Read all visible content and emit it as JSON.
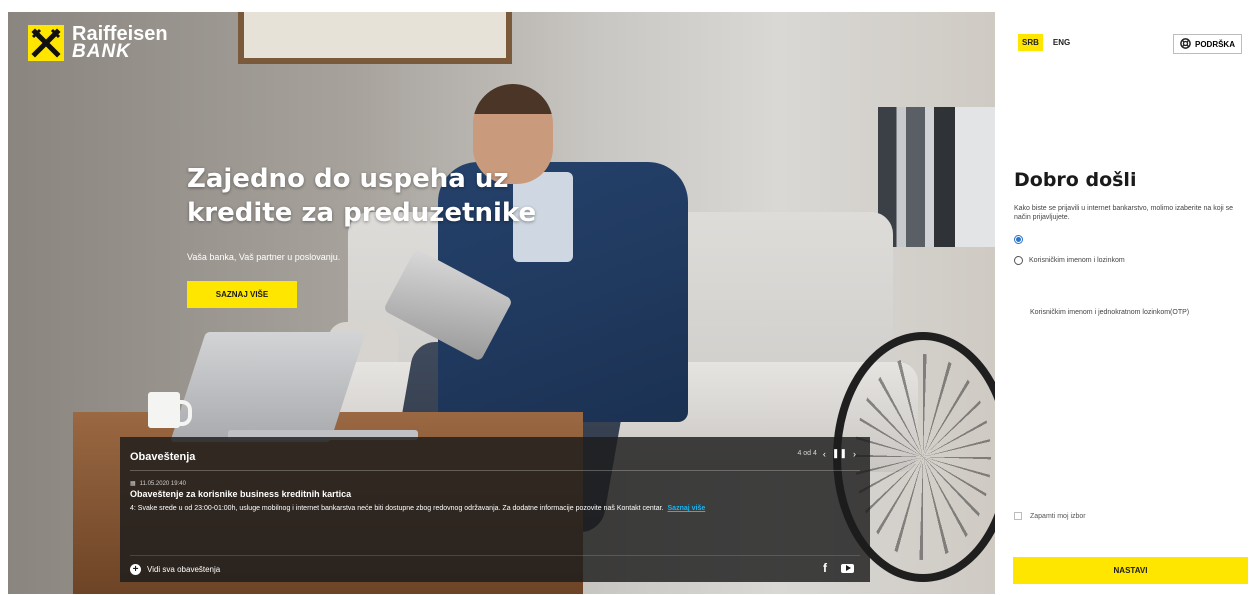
{
  "brand": {
    "name_line1": "Raiffeisen",
    "name_line2": "BANK",
    "logo_icon": "raiffeisen-crossed-gables-icon",
    "brand_color": "#ffe600"
  },
  "hero": {
    "headline": "Zajedno do uspeha uz kredite za preduzetnike",
    "subheadline": "Vaša banka, Vaš partner u poslovanju.",
    "cta_label": "SAZNAJ VIŠE"
  },
  "notifications": {
    "heading": "Obaveštenja",
    "pager": "4 od 4",
    "prev_icon": "chevron-left-icon",
    "pause_icon": "pause-icon",
    "next_icon": "chevron-right-icon",
    "item": {
      "date": "11.05.2020 19:40",
      "title": "Obaveštenje za korisnike business kreditnih kartica",
      "body": "4: Svake srede u od 23:00-01:00h, usluge mobilnog i internet bankarstva neće biti dostupne zbog redovnog održavanja. Za dodatne informacije pozovite naš Kontakt centar.",
      "link_label": "Saznaj više"
    },
    "see_all_label": "Vidi sva obaveštenja",
    "social": [
      "facebook-icon",
      "youtube-icon"
    ]
  },
  "login_panel": {
    "languages": [
      {
        "code": "SRB",
        "active": true
      },
      {
        "code": "ENG",
        "active": false
      }
    ],
    "support_label": "PODRŠKA",
    "welcome_title": "Dobro došli",
    "intro_text": "Kako biste se prijavili u internet bankarstvo, molimo izaberite na koji se način prijavljujete.",
    "options": [
      {
        "label": "",
        "selected": true
      },
      {
        "label": "Korisničkim imenom i lozinkom",
        "selected": false
      },
      {
        "label": "Korisničkim imenom i jednokratnom lozinkom(OTP)",
        "selected": false
      }
    ],
    "remember_label": "Zapamti moj izbor",
    "remember_checked": false,
    "submit_label": "NASTAVI"
  }
}
